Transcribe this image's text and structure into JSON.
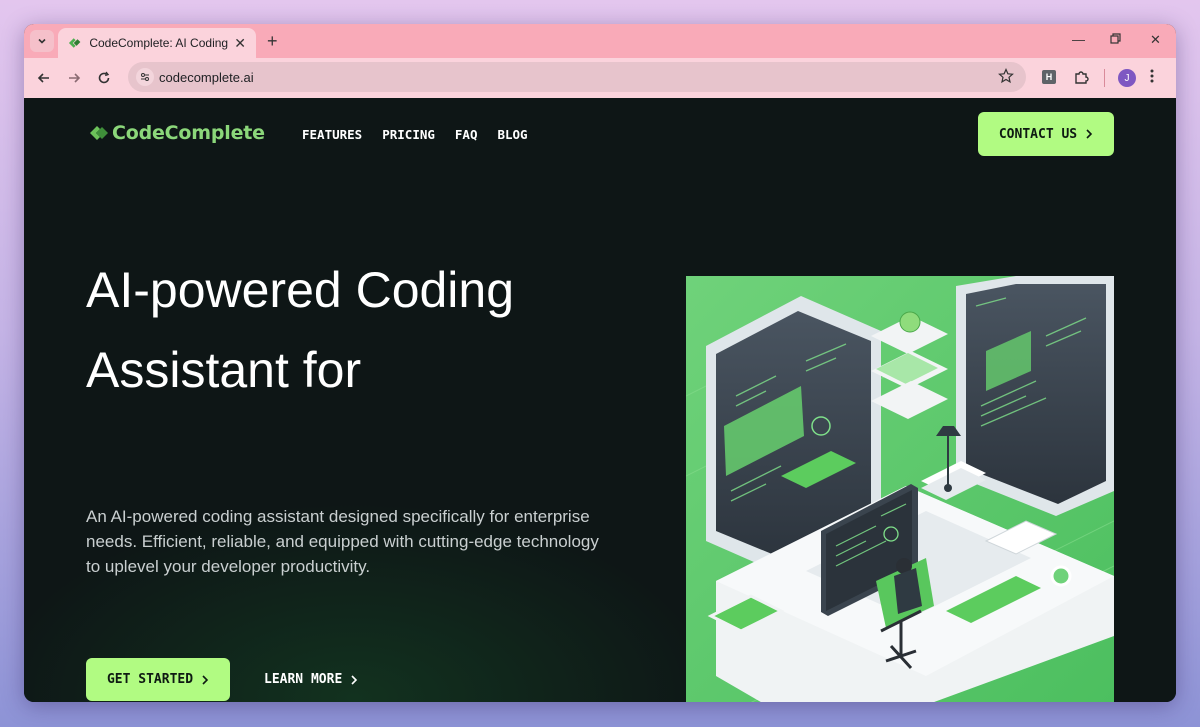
{
  "browser": {
    "tab_title": "CodeComplete: AI Coding Assis",
    "url": "codecomplete.ai",
    "profile_initial": "J",
    "extension_label": "H"
  },
  "site": {
    "logo_text": "CodeComplete",
    "nav": [
      "FEATURES",
      "PRICING",
      "FAQ",
      "BLOG"
    ],
    "contact_label": "CONTACT US",
    "hero": {
      "title_line1": "AI-powered Coding",
      "title_line2": "Assistant for",
      "description": "An AI-powered coding assistant designed specifically for enterprise needs. Efficient, reliable, and equipped with cutting-edge technology to uplevel your developer productivity."
    },
    "cta_primary": "GET STARTED",
    "cta_secondary": "LEARN MORE"
  },
  "colors": {
    "accent": "#b1fb82",
    "logo": "#8bd77a",
    "page_bg": "#0e1616",
    "tabstrip": "#f9aab8"
  },
  "icons": [
    "tab-search-icon",
    "favicon",
    "close-icon",
    "plus-icon",
    "minimize-icon",
    "restore-icon",
    "back-icon",
    "forward-icon",
    "reload-icon",
    "site-info-icon",
    "star-icon",
    "puzzle-icon",
    "more-menu-icon",
    "chevron-right-icon"
  ]
}
